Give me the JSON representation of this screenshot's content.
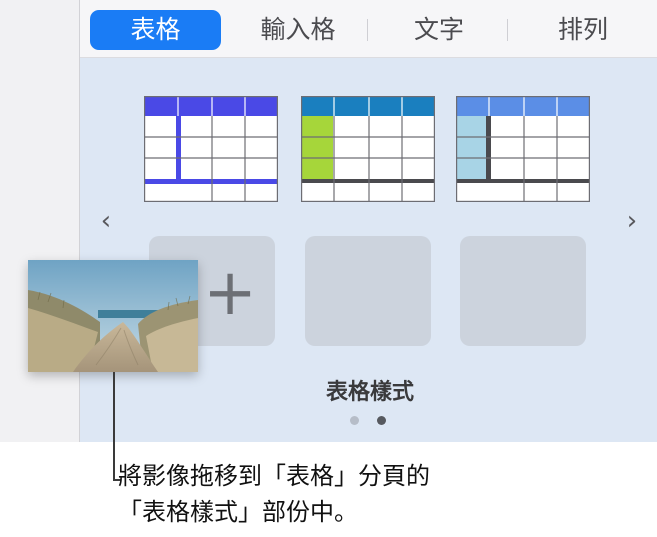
{
  "tabs": [
    {
      "label": "表格",
      "active": true
    },
    {
      "label": "輸入格",
      "active": false
    },
    {
      "label": "文字",
      "active": false
    },
    {
      "label": "排列",
      "active": false
    }
  ],
  "nav": {
    "prev_icon": "chevron-left-icon",
    "next_icon": "chevron-right-icon"
  },
  "add_style_icon": "plus-icon",
  "section_label": "表格樣式",
  "pagination": {
    "pages": 2,
    "current": 2
  },
  "callout": {
    "line1": "將影像拖移到「表格」分頁的",
    "line2": "「表格樣式」部份中。"
  },
  "colors": {
    "accent": "#1a7cf5",
    "style1": "#4a49e6",
    "style2_header": "#1a7fbf",
    "style2_column": "#a6d63a",
    "style3_header": "#5b8ee6",
    "style3_column": "#a8d4e6"
  }
}
